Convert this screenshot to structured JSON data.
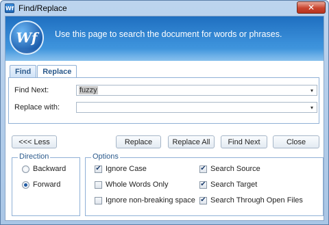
{
  "window": {
    "title": "Find/Replace",
    "close_glyph": "✕",
    "icon": "wf-app-icon"
  },
  "header": {
    "logo_text": "Wf",
    "message": "Use this page to search the document for words or phrases."
  },
  "tabs": [
    {
      "label": "Find",
      "active": false
    },
    {
      "label": "Replace",
      "active": true
    }
  ],
  "fields": {
    "find_next_label": "Find Next:",
    "find_next_value": "fuzzy",
    "replace_with_label": "Replace with:",
    "replace_with_value": "",
    "dropdown_glyph": "▾"
  },
  "buttons": {
    "less": "<<< Less",
    "replace": "Replace",
    "replace_all": "Replace All",
    "find_next": "Find Next",
    "close": "Close"
  },
  "direction": {
    "legend": "Direction",
    "options": [
      {
        "label": "Backward",
        "selected": false
      },
      {
        "label": "Forward",
        "selected": true
      }
    ]
  },
  "options": {
    "legend": "Options",
    "items": [
      {
        "label": "Ignore Case",
        "checked": true
      },
      {
        "label": "Whole Words Only",
        "checked": false
      },
      {
        "label": "Ignore non-breaking space",
        "checked": false
      },
      {
        "label": "Search Source",
        "checked": true
      },
      {
        "label": "Search Target",
        "checked": true
      },
      {
        "label": "Search Through Open Files",
        "checked": true
      }
    ],
    "check_glyph": "✔"
  },
  "colors": {
    "accent": "#1f6fc0",
    "tab_text": "#2b5a8c",
    "close_red": "#c9452f"
  }
}
